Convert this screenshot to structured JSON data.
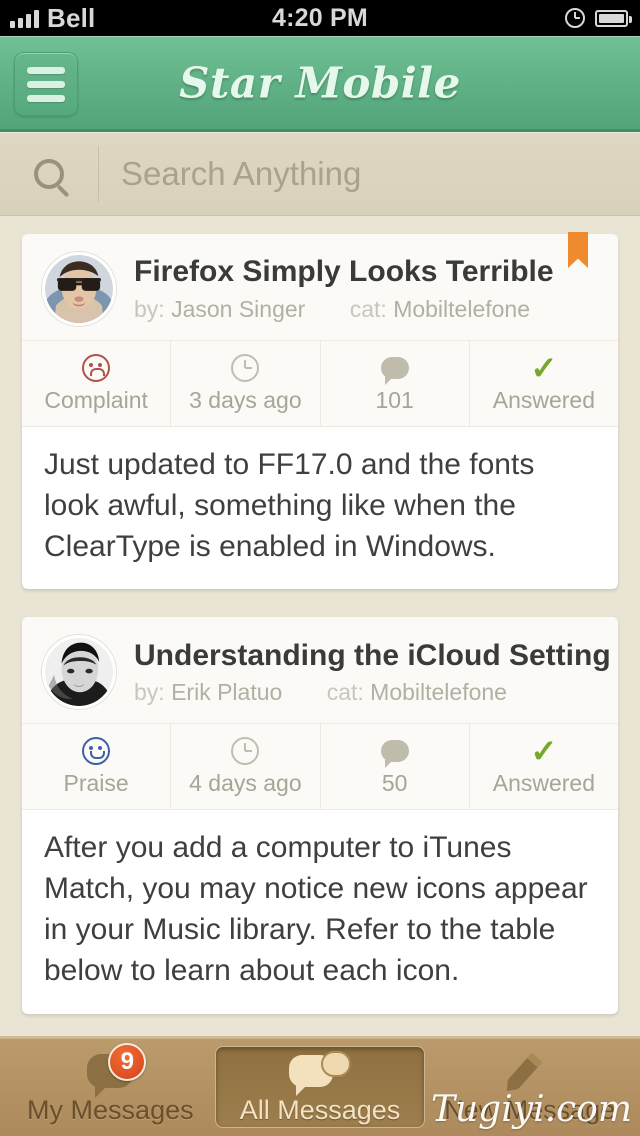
{
  "status_bar": {
    "carrier": "Bell",
    "time": "4:20 PM",
    "signal_icon": "signal-bars-icon",
    "alarm_icon": "alarm-clock-icon",
    "battery_icon": "battery-full-icon"
  },
  "app_bar": {
    "title": "Star Mobile",
    "menu_icon": "hamburger-menu-icon",
    "background_color": "#5fb085"
  },
  "search": {
    "placeholder": "Search Anything",
    "value": "",
    "icon": "search-icon"
  },
  "cards": [
    {
      "title": "Firefox Simply Looks Terrible",
      "author_label": "by:",
      "author": "Jason Singer",
      "category_label": "cat:",
      "category": "Mobiltelefone",
      "bookmarked": true,
      "bookmark_icon": "bookmark-ribbon-icon",
      "avatar_icon": "avatar-jason-singer",
      "meta": [
        {
          "icon": "sad-face-icon",
          "label": "Complaint",
          "color": "#b4504a"
        },
        {
          "icon": "clock-icon",
          "label": "3 days ago",
          "color": "#c2beae"
        },
        {
          "icon": "comment-bubble-icon",
          "label": "101",
          "color": "#c0bcab"
        },
        {
          "icon": "checkmark-icon",
          "label": "Answered",
          "color": "#77a82e"
        }
      ],
      "body": "Just updated to FF17.0 and the fonts look awful, something like when the ClearType is enabled in Windows."
    },
    {
      "title": "Understanding the iCloud Setting",
      "author_label": "by:",
      "author": "Erik Platuo",
      "category_label": "cat:",
      "category": "Mobiltelefone",
      "bookmarked": false,
      "bookmark_icon": "bookmark-ribbon-icon",
      "avatar_icon": "avatar-erik-platuo",
      "meta": [
        {
          "icon": "happy-face-icon",
          "label": "Praise",
          "color": "#3f5fa8"
        },
        {
          "icon": "clock-icon",
          "label": "4 days ago",
          "color": "#c2beae"
        },
        {
          "icon": "comment-bubble-icon",
          "label": "50",
          "color": "#c0bcab"
        },
        {
          "icon": "checkmark-icon",
          "label": "Answered",
          "color": "#77a82e"
        }
      ],
      "body": "After you add a computer to iTunes Match, you may notice new icons appear in your Music library. Refer to the table below to learn about each icon."
    }
  ],
  "tab_bar": {
    "tabs": [
      {
        "label": "My Messages",
        "icon": "speech-bubble-icon",
        "badge": "9",
        "active": false
      },
      {
        "label": "All Messages",
        "icon": "double-speech-bubble-icon",
        "badge": "",
        "active": true
      },
      {
        "label": "New Message",
        "icon": "pencil-icon",
        "badge": "",
        "active": false
      }
    ],
    "badge_color": "#e04f20",
    "active_color": "#8f7040"
  },
  "watermark": "Tugiyi.com"
}
